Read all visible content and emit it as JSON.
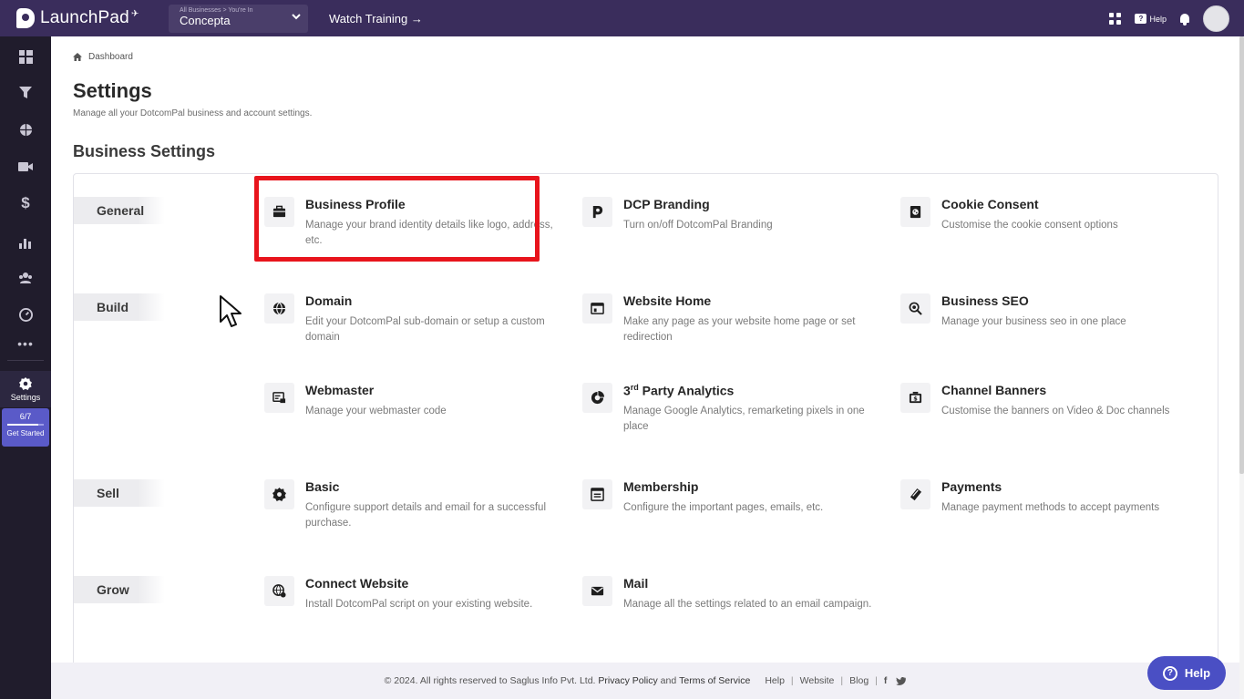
{
  "topbar": {
    "logo_text": "LaunchPad",
    "business_hint": "All Businesses > You're In",
    "business_name": "Concepta",
    "watch_training": "Watch Training →",
    "help_label": "Help"
  },
  "sidebar": {
    "settings_label": "Settings",
    "get_started_count": "6/7",
    "get_started_progress": 0.86,
    "get_started_label": "Get Started"
  },
  "breadcrumb": {
    "label": "Dashboard"
  },
  "page": {
    "title": "Settings",
    "subtitle": "Manage all your DotcomPal business and account settings.",
    "section_title": "Business Settings"
  },
  "groups": {
    "general": "General",
    "build": "Build",
    "sell": "Sell",
    "grow": "Grow"
  },
  "items": {
    "business_profile": {
      "title": "Business Profile",
      "desc": "Manage your brand identity details like logo, address, etc.",
      "icon": "briefcase-icon"
    },
    "dcp_branding": {
      "title": "DCP Branding",
      "desc": "Turn on/off DotcomPal Branding",
      "icon": "dcp-logo-icon"
    },
    "cookie_consent": {
      "title": "Cookie Consent",
      "desc": "Customise the cookie consent options",
      "icon": "cookie-icon"
    },
    "domain": {
      "title": "Domain",
      "desc": "Edit your DotcomPal sub-domain or setup a custom domain",
      "icon": "globe-icon"
    },
    "website_home": {
      "title": "Website Home",
      "desc": "Make any page as your website home page or set redirection",
      "icon": "webpage-icon"
    },
    "business_seo": {
      "title": "Business SEO",
      "desc": "Manage your business seo in one place",
      "icon": "seo-search-icon"
    },
    "webmaster": {
      "title": "Webmaster",
      "desc": "Manage your webmaster code",
      "icon": "webmaster-icon"
    },
    "third_party_analytics": {
      "title_prefix": "3",
      "title_sup": "rd",
      "title_rest": " Party Analytics",
      "desc": "Manage Google Analytics, remarketing pixels in one place",
      "icon": "analytics-icon"
    },
    "channel_banners": {
      "title": "Channel Banners",
      "desc": "Customise the banners on Video & Doc channels",
      "icon": "banner-icon"
    },
    "basic": {
      "title": "Basic",
      "desc": "Configure support details and email for a successful purchase.",
      "icon": "gear-icon"
    },
    "membership": {
      "title": "Membership",
      "desc": "Configure the important pages, emails, etc.",
      "icon": "membership-icon"
    },
    "payments": {
      "title": "Payments",
      "desc": "Manage payment methods to accept payments",
      "icon": "payment-card-icon"
    },
    "connect_website": {
      "title": "Connect Website",
      "desc": "Install DotcomPal script on your existing website.",
      "icon": "connect-globe-icon"
    },
    "mail": {
      "title": "Mail",
      "desc": "Manage all the settings related to an email campaign.",
      "icon": "mail-icon"
    }
  },
  "footer": {
    "copyright": "©  2024. All rights reserved to Saglus Info Pvt. Ltd.",
    "privacy": "Privacy Policy",
    "and": "and",
    "terms": "Terms of Service",
    "help": "Help",
    "website": "Website",
    "blog": "Blog",
    "facebook": "f"
  },
  "help_button": {
    "label": "Help"
  },
  "colors": {
    "topbar": "#3a2d5c",
    "sidebar": "#201c2c",
    "highlight": "#e8141c",
    "help_fab": "#4a4fc4"
  }
}
